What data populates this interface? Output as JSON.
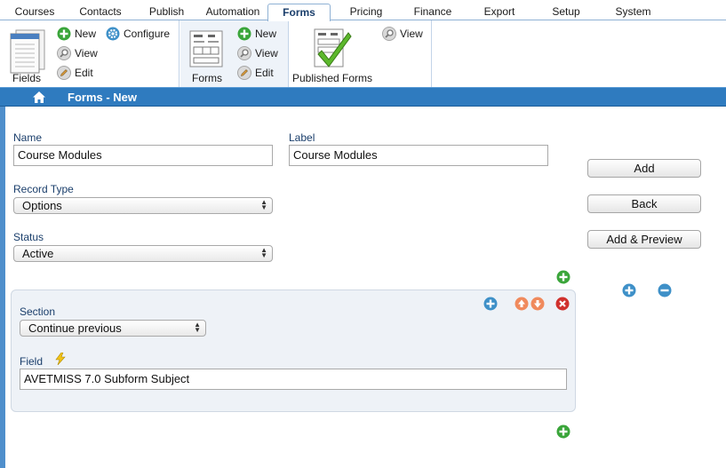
{
  "tabs": [
    {
      "label": "Courses"
    },
    {
      "label": "Contacts"
    },
    {
      "label": "Publish"
    },
    {
      "label": "Automation"
    },
    {
      "label": "Forms"
    },
    {
      "label": "Pricing"
    },
    {
      "label": "Finance"
    },
    {
      "label": "Export"
    },
    {
      "label": "Setup"
    },
    {
      "label": "System"
    }
  ],
  "active_tab": "Forms",
  "ribbon": {
    "fields": {
      "label": "Fields",
      "new": "New",
      "configure": "Configure",
      "view": "View",
      "edit": "Edit"
    },
    "forms": {
      "label": "Forms",
      "new": "New",
      "view": "View",
      "edit": "Edit"
    },
    "published": {
      "label": "Published Forms",
      "view": "View"
    }
  },
  "page": {
    "title": "Forms - New"
  },
  "form": {
    "name_label": "Name",
    "name_value": "Course Modules",
    "label_label": "Label",
    "label_value": "Course Modules",
    "record_type_label": "Record Type",
    "record_type_value": "Options",
    "status_label": "Status",
    "status_value": "Active"
  },
  "buttons": {
    "add": "Add",
    "back": "Back",
    "add_preview": "Add & Preview"
  },
  "section": {
    "section_label": "Section",
    "section_value": "Continue previous",
    "field_label": "Field",
    "field_value": "AVETMISS 7.0 Subform Subject"
  },
  "colors": {
    "title_bar": "#2f7bbf",
    "add_green": "#3aa53a",
    "plus_blue": "#3e90c8",
    "move_orange": "#f08a5d",
    "delete_red": "#d0312d"
  },
  "icons": [
    "home-icon",
    "plus-icon",
    "minus-icon",
    "gear-icon",
    "magnifier-icon",
    "pencil-icon",
    "lightning-icon",
    "arrow-up-icon",
    "arrow-down-icon",
    "delete-icon"
  ]
}
